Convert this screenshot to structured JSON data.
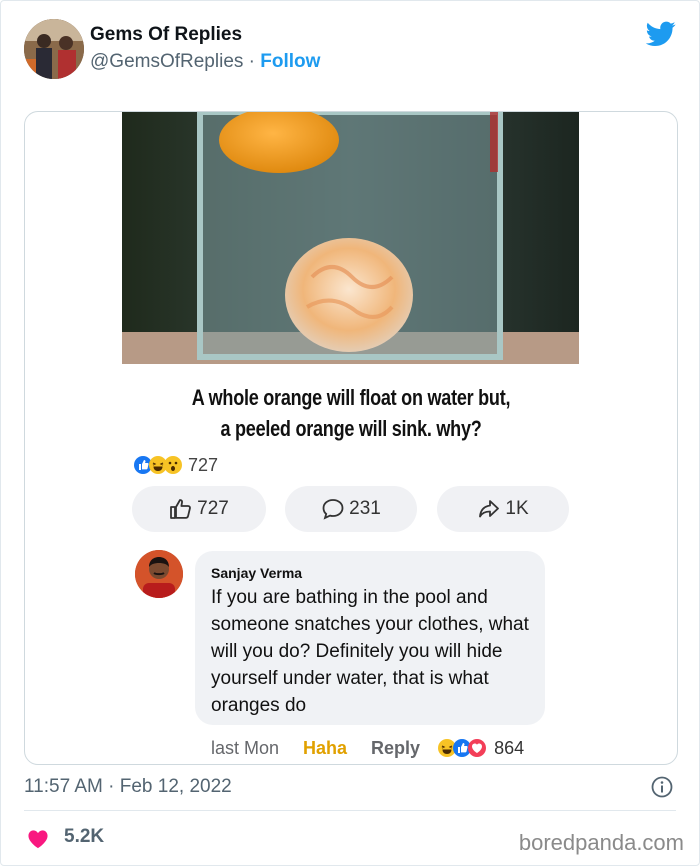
{
  "author": {
    "name": "Gems Of Replies",
    "handle": "@GemsOfReplies",
    "separator": "·",
    "follow_label": "Follow"
  },
  "post": {
    "question_line1": "A whole orange will float on water but,",
    "question_line2": "a peeled orange will sink. why?",
    "reactions_count": "727",
    "actions": [
      {
        "label": "727",
        "icon": "thumbs-up-icon"
      },
      {
        "label": "231",
        "icon": "comment-icon"
      },
      {
        "label": "1K",
        "icon": "share-icon"
      }
    ]
  },
  "comment": {
    "author": "Sanjay Verma",
    "text": "If you are bathing in the pool and someone snatches your clothes, what will you do? Definitely you will hide yourself under water, that is what oranges do",
    "time": "last Mon",
    "haha_label": "Haha",
    "reply_label": "Reply",
    "reactions_count": "864"
  },
  "footer": {
    "timestamp": "11:57 AM · Feb 12, 2022",
    "likes": "5.2K",
    "watermark": "boredpanda.com"
  },
  "colors": {
    "twitter_blue": "#1d9bf0",
    "heart": "#f91880",
    "haha": "#e1a100"
  }
}
